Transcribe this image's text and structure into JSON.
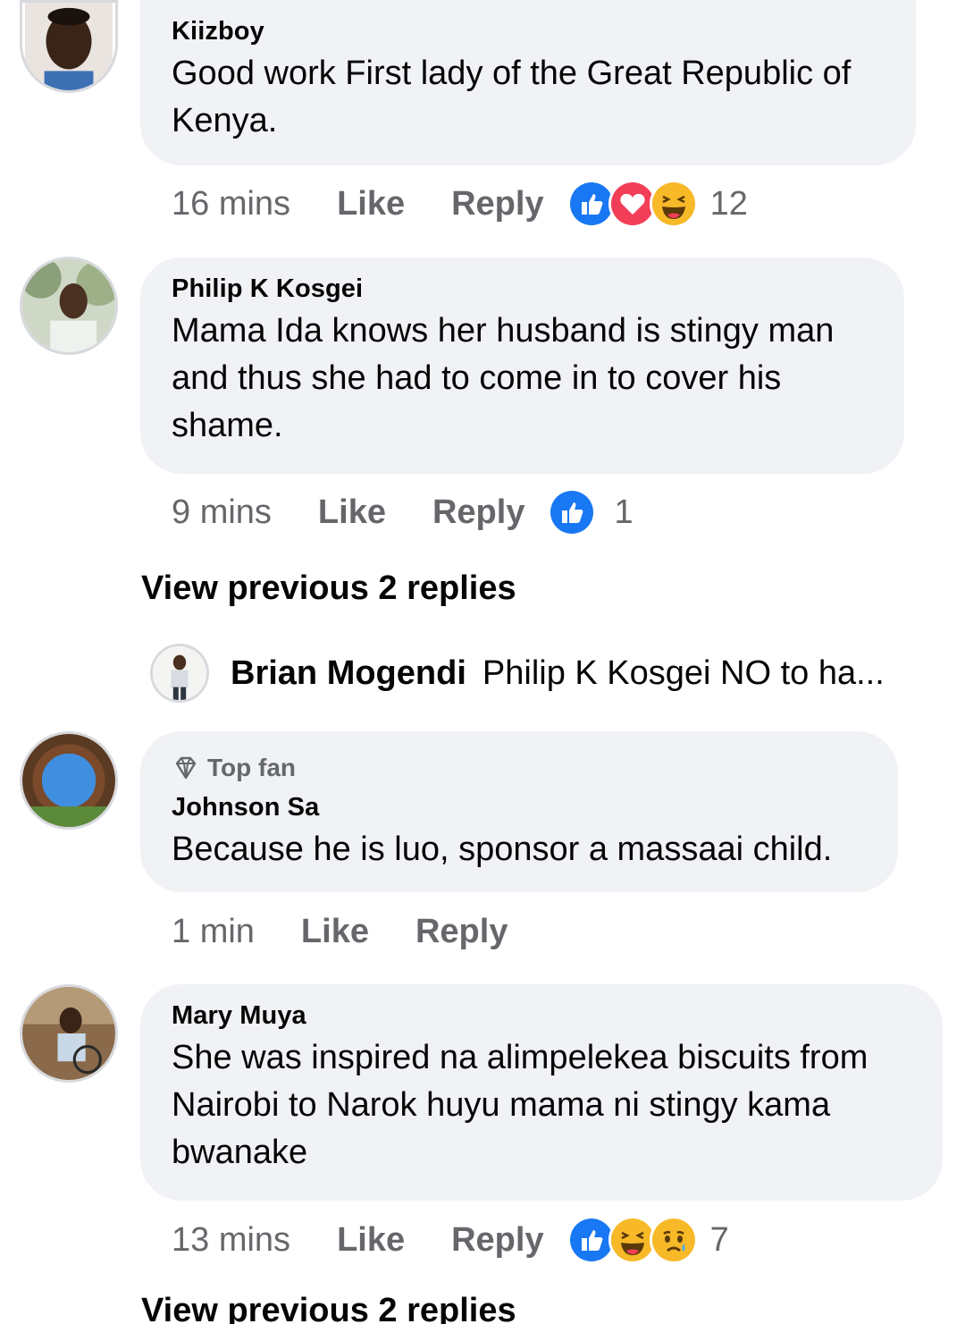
{
  "comments": [
    {
      "author": "Kiizboy",
      "text": "Good work First lady of the Great Republic of Kenya.",
      "time": "16 mins",
      "like_label": "Like",
      "reply_label": "Reply",
      "reactions": [
        "like",
        "love",
        "haha"
      ],
      "reaction_count": "12"
    },
    {
      "author": "Philip K Kosgei",
      "text": "Mama Ida knows her husband is stingy man and thus she had to come in to cover his shame.",
      "time": "9 mins",
      "like_label": "Like",
      "reply_label": "Reply",
      "reactions": [
        "like"
      ],
      "reaction_count": "1",
      "view_replies_label": "View previous 2 replies",
      "reply_preview": {
        "author": "Brian Mogendi",
        "text": "Philip K Kosgei NO to ha..."
      }
    },
    {
      "badge": "Top fan",
      "badge_icon": "diamond-icon",
      "author": "Johnson Sa",
      "text": "Because he is luo, sponsor a massaai child.",
      "time": "1 min",
      "like_label": "Like",
      "reply_label": "Reply"
    },
    {
      "author": "Mary Muya",
      "text": "She was inspired na alimpelekea biscuits from Nairobi to Narok huyu mama ni stingy kama bwanake",
      "time": "13 mins",
      "like_label": "Like",
      "reply_label": "Reply",
      "reactions": [
        "like",
        "haha",
        "sad"
      ],
      "reaction_count": "7",
      "view_replies_label": "View previous 2 replies"
    }
  ],
  "colors": {
    "bubble": "#f0f2f5",
    "secondary_text": "#65676b",
    "like_blue": "#1877f2",
    "love_red": "#f33e58",
    "emoji_yellow": "#f7b928"
  }
}
